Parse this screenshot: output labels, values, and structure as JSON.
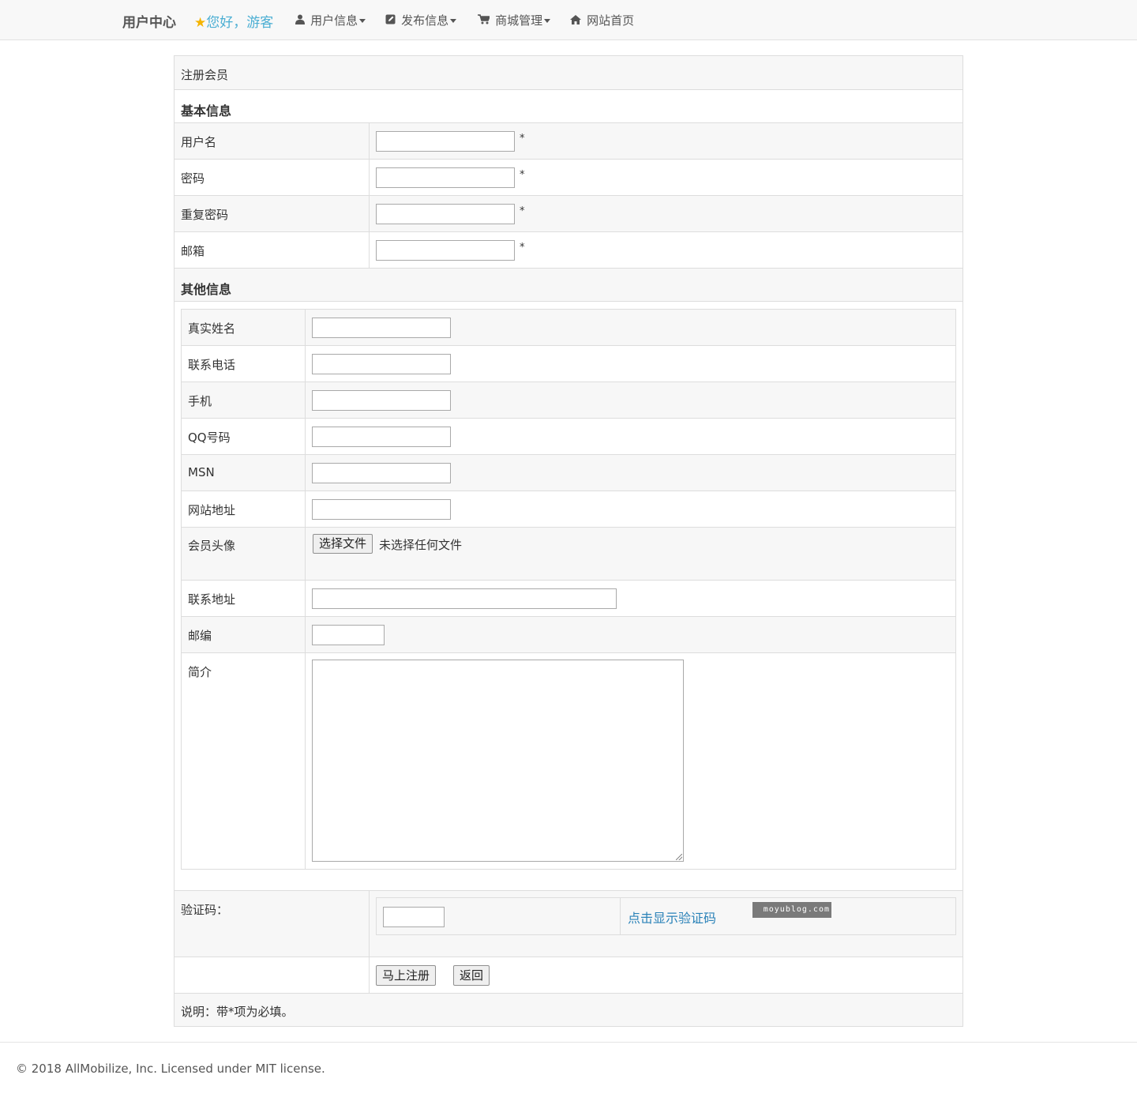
{
  "nav": {
    "brand": "用户中心",
    "greeting": "您好，游客",
    "items": [
      {
        "label": "用户信息",
        "icon": "user-icon"
      },
      {
        "label": "发布信息",
        "icon": "edit-icon"
      },
      {
        "label": "商城管理",
        "icon": "cart-icon"
      },
      {
        "label": "网站首页",
        "icon": "home-icon"
      }
    ]
  },
  "form": {
    "title": "注册会员",
    "basic_section": "基本信息",
    "basic_fields": [
      {
        "label": "用户名",
        "required_mark": "*"
      },
      {
        "label": "密码",
        "required_mark": "*"
      },
      {
        "label": "重复密码",
        "required_mark": "*"
      },
      {
        "label": "邮箱",
        "required_mark": "*"
      }
    ],
    "other_section": "其他信息",
    "other_fields": [
      {
        "label": "真实姓名"
      },
      {
        "label": "联系电话"
      },
      {
        "label": "手机"
      },
      {
        "label": "QQ号码"
      },
      {
        "label": "MSN"
      },
      {
        "label": "网站地址"
      }
    ],
    "avatar": {
      "label": "会员头像",
      "button": "选择文件",
      "status": "未选择任何文件"
    },
    "address": {
      "label": "联系地址"
    },
    "zip": {
      "label": "邮编"
    },
    "intro": {
      "label": "简介"
    },
    "captcha": {
      "label": "验证码：",
      "link": "点击显示验证码",
      "image_text": "moyublog.com"
    },
    "buttons": {
      "submit": "马上注册",
      "back": "返回"
    },
    "note": "说明：带*项为必填。"
  },
  "footer": {
    "text": "© 2018 AllMobilize, Inc. Licensed under MIT license."
  }
}
